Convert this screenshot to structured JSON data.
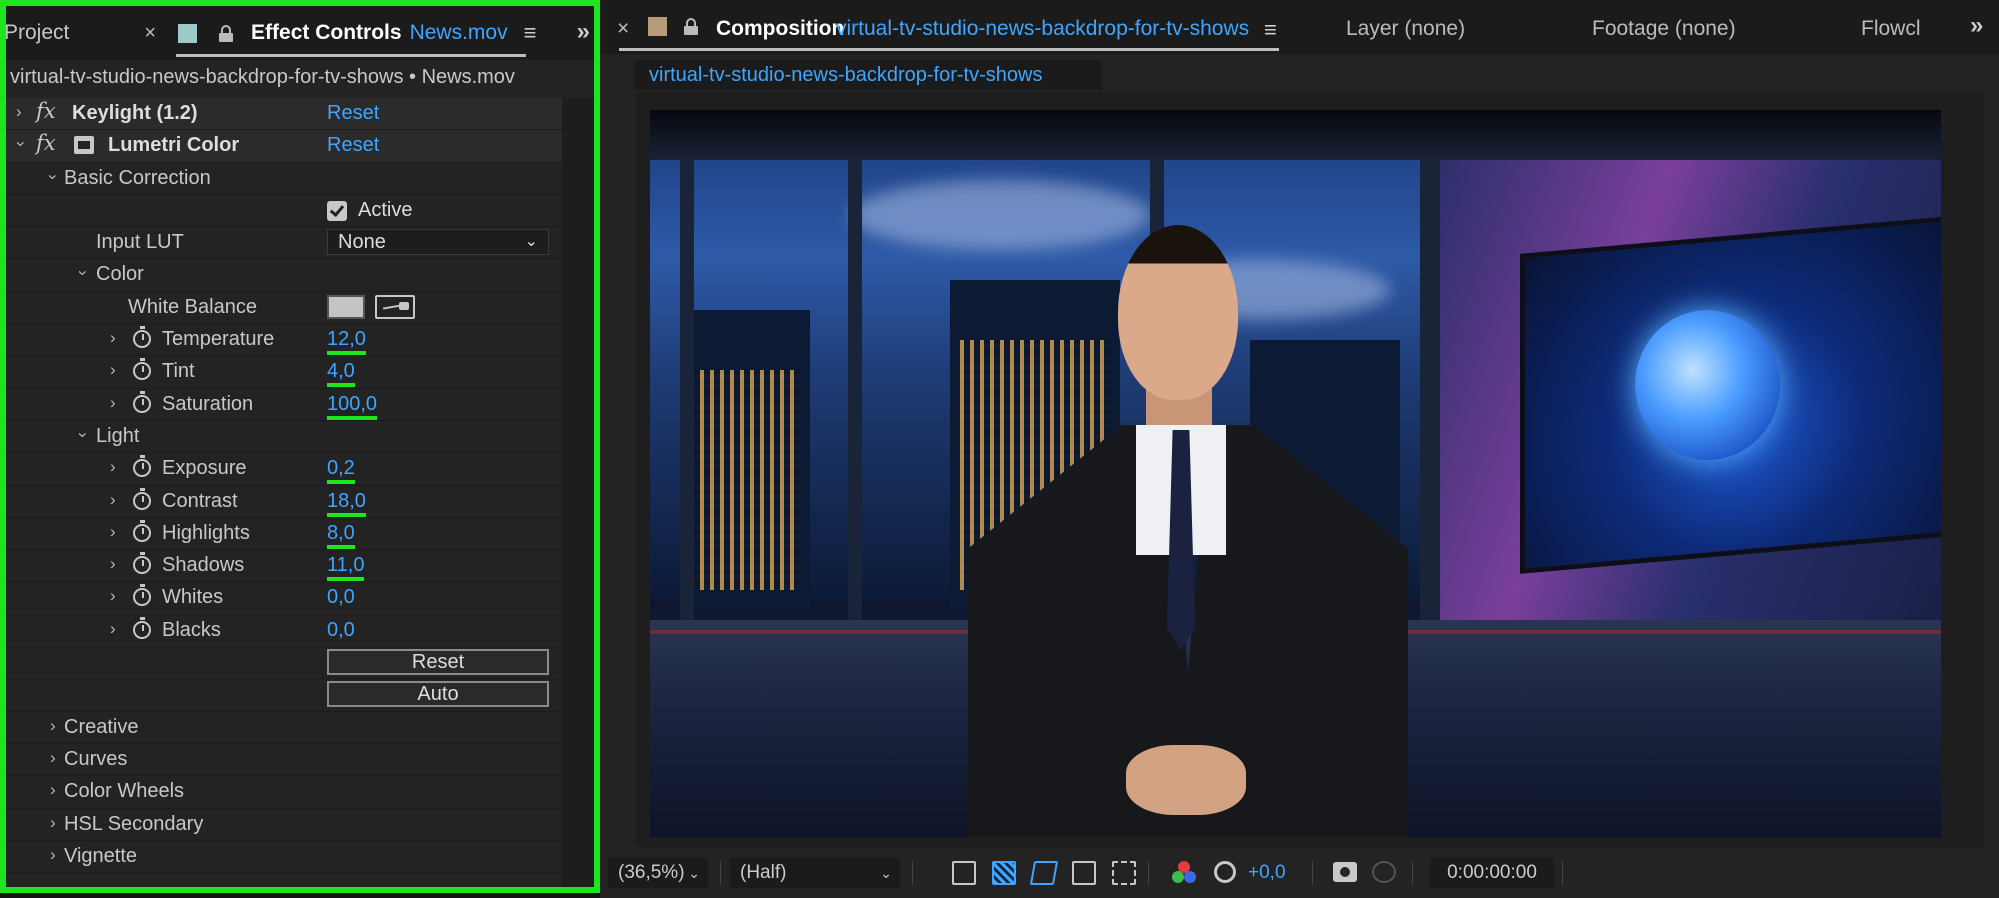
{
  "effect_panel": {
    "project_tab": "Project",
    "close_glyph": "×",
    "tab_title": "Effect Controls",
    "tab_file": "News.mov",
    "menu_glyph": "≡",
    "overflow_glyph": "»",
    "breadcrumb": "virtual-tv-studio-news-backdrop-for-tv-shows • News.mov",
    "swatch_color": "#9ec9c6",
    "highlight_color": "#1ee61e",
    "rows": {
      "keylight": {
        "name": "Keylight (1.2)",
        "reset": "Reset"
      },
      "lumetri": {
        "name": "Lumetri Color",
        "reset": "Reset"
      },
      "basic_correction": "Basic Correction",
      "active": "Active",
      "input_lut": {
        "label": "Input LUT",
        "value": "None"
      },
      "color_group": "Color",
      "white_balance": "White Balance",
      "temperature": {
        "label": "Temperature",
        "value": "12,0"
      },
      "tint": {
        "label": "Tint",
        "value": "4,0"
      },
      "saturation": {
        "label": "Saturation",
        "value": "100,0"
      },
      "light_group": "Light",
      "exposure": {
        "label": "Exposure",
        "value": "0,2"
      },
      "contrast": {
        "label": "Contrast",
        "value": "18,0"
      },
      "highlights": {
        "label": "Highlights",
        "value": "8,0"
      },
      "shadows": {
        "label": "Shadows",
        "value": "11,0"
      },
      "whites": {
        "label": "Whites",
        "value": "0,0"
      },
      "blacks": {
        "label": "Blacks",
        "value": "0,0"
      },
      "reset_button": "Reset",
      "auto_button": "Auto",
      "creative": "Creative",
      "curves": "Curves",
      "color_wheels": "Color Wheels",
      "hsl_secondary": "HSL Secondary",
      "vignette": "Vignette"
    }
  },
  "composition_panel": {
    "close_glyph": "×",
    "swatch_color": "#b79c7a",
    "tab_title": "Composition",
    "comp_name": "virtual-tv-studio-news-backdrop-for-tv-shows",
    "menu_glyph": "≡",
    "layer_tab": "Layer (none)",
    "footage_tab": "Footage (none)",
    "flowchart_tab": "Flowcl",
    "overflow_glyph": "»",
    "sub_tab": "virtual-tv-studio-news-backdrop-for-tv-shows"
  },
  "viewer_toolbar": {
    "zoom": "(36,5%)",
    "resolution": "(Half)",
    "exposure_value": "+0,0",
    "timecode": "0:00:00:00",
    "dropdown_glyph": "⌄"
  }
}
